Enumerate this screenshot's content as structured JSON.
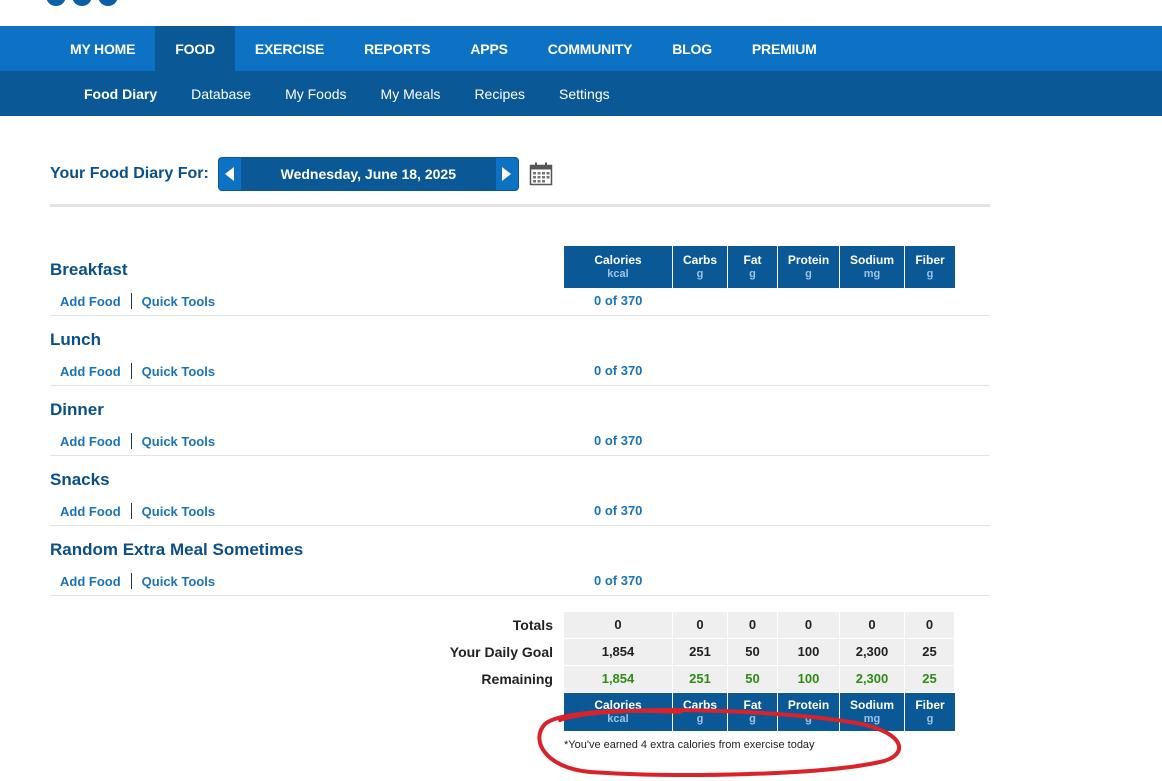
{
  "nav_main": [
    "MY HOME",
    "FOOD",
    "EXERCISE",
    "REPORTS",
    "APPS",
    "COMMUNITY",
    "BLOG",
    "PREMIUM"
  ],
  "nav_main_active": "FOOD",
  "nav_sub": [
    "Food Diary",
    "Database",
    "My Foods",
    "My Meals",
    "Recipes",
    "Settings"
  ],
  "nav_sub_active": "Food Diary",
  "diary": {
    "label": "Your Food Diary For:",
    "date": "Wednesday, June 18, 2025"
  },
  "columns": [
    {
      "name": "Calories",
      "unit": "kcal"
    },
    {
      "name": "Carbs",
      "unit": "g"
    },
    {
      "name": "Fat",
      "unit": "g"
    },
    {
      "name": "Protein",
      "unit": "g"
    },
    {
      "name": "Sodium",
      "unit": "mg"
    },
    {
      "name": "Fiber",
      "unit": "g"
    }
  ],
  "meals": [
    {
      "title": "Breakfast",
      "add": "Add Food",
      "tools": "Quick Tools",
      "calories": "0 of 370"
    },
    {
      "title": "Lunch",
      "add": "Add Food",
      "tools": "Quick Tools",
      "calories": "0 of 370"
    },
    {
      "title": "Dinner",
      "add": "Add Food",
      "tools": "Quick Tools",
      "calories": "0 of 370"
    },
    {
      "title": "Snacks",
      "add": "Add Food",
      "tools": "Quick Tools",
      "calories": "0 of 370"
    },
    {
      "title": "Random Extra Meal Sometimes",
      "add": "Add Food",
      "tools": "Quick Tools",
      "calories": "0 of 370"
    }
  ],
  "totals": [
    {
      "label": "Totals",
      "values": [
        "0",
        "0",
        "0",
        "0",
        "0",
        "0"
      ]
    },
    {
      "label": "Your Daily Goal",
      "values": [
        "1,854",
        "251",
        "50",
        "100",
        "2,300",
        "25"
      ]
    },
    {
      "label": "Remaining",
      "values": [
        "1,854",
        "251",
        "50",
        "100",
        "2,300",
        "25"
      ]
    }
  ],
  "exercise_note": "*You've earned 4 extra calories from exercise today",
  "colors": {
    "nav_main": "#0e72c4",
    "nav_sub": "#0b5897",
    "remaining": "#2e8c14",
    "annotation": "#d9222a"
  }
}
